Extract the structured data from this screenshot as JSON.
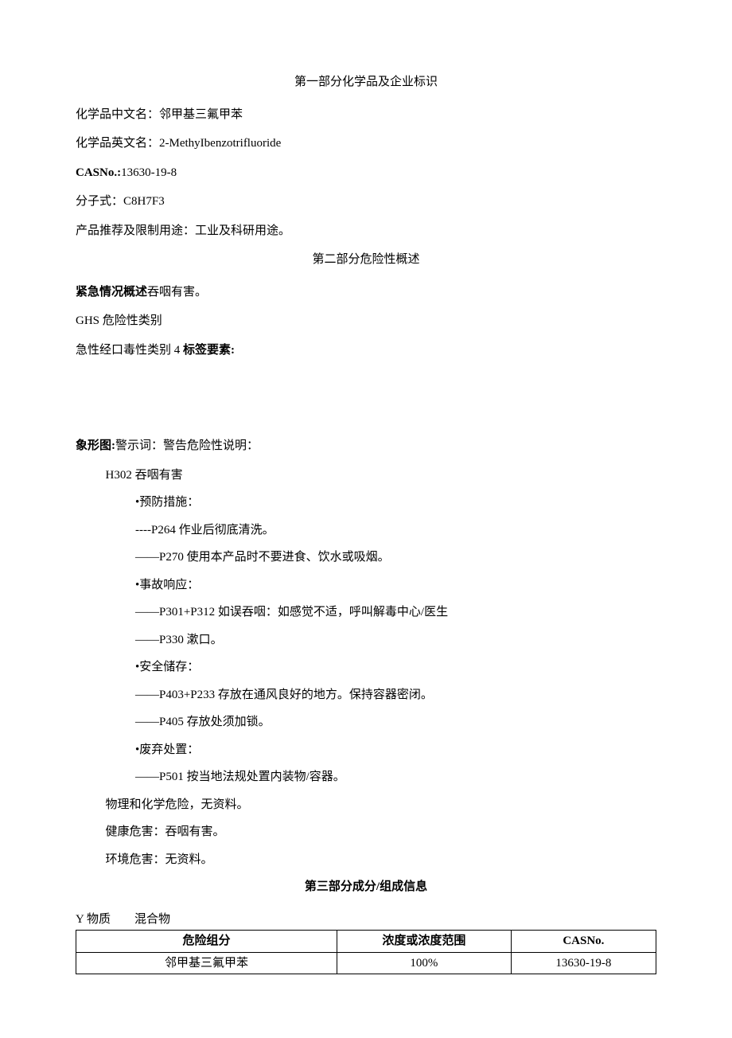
{
  "section1": {
    "title": "第一部分化学品及企业标识",
    "name_cn_label": "化学品中文名：",
    "name_cn_value": "邻甲基三氟甲苯",
    "name_en_label": "化学品英文名：",
    "name_en_value": "2-MethyIbenzotrifluoride",
    "cas_label": "CASNo.:",
    "cas_value": "13630-19-8",
    "formula_label": "分子式：",
    "formula_value": "C8H7F3",
    "use_label": "产品推荐及限制用途：",
    "use_value": "工业及科研用途。"
  },
  "section2": {
    "title": "第二部分危险性概述",
    "emergency_label": "紧急情况概述",
    "emergency_value": "吞咽有害。",
    "ghs_label": "GHS 危险性类别",
    "acute_text": "急性经口毒性类别 4 ",
    "tag_label": "标签要素:",
    "pictogram_label": "象形图:",
    "signal_label": "警示词：",
    "signal_value": "警告",
    "hazard_label": "危险性说明：",
    "h302": "H302 吞咽有害",
    "prevention_header": "•预防措施：",
    "p264": "----P264 作业后彻底清洗。",
    "p270": "——P270 使用本产品时不要进食、饮水或吸烟。",
    "response_header": "•事故响应：",
    "p301": "——P301+P312 如误吞咽：如感觉不适，呼叫解毒中心/医生",
    "p330": "——P330 漱口。",
    "storage_header": "•安全储存：",
    "p403": "——P403+P233 存放在通风良好的地方。保持容器密闭。",
    "p405": "——P405 存放处须加锁。",
    "disposal_header": "•废弃处置：",
    "p501": "——P501 按当地法规处置内装物/容器。",
    "physical": "物理和化学危险，无资料。",
    "health": "健康危害：吞咽有害。",
    "env": "环境危害：无资料。"
  },
  "section3": {
    "title": "第三部分成分/组成信息",
    "subst_prefix": "Y 物质",
    "subst_mix": "混合物",
    "th1": "危险组分",
    "th2": "浓度或浓度范围",
    "th3": "CASNo.",
    "td1": "邻甲基三氟甲苯",
    "td2": "100%",
    "td3": "13630-19-8"
  }
}
